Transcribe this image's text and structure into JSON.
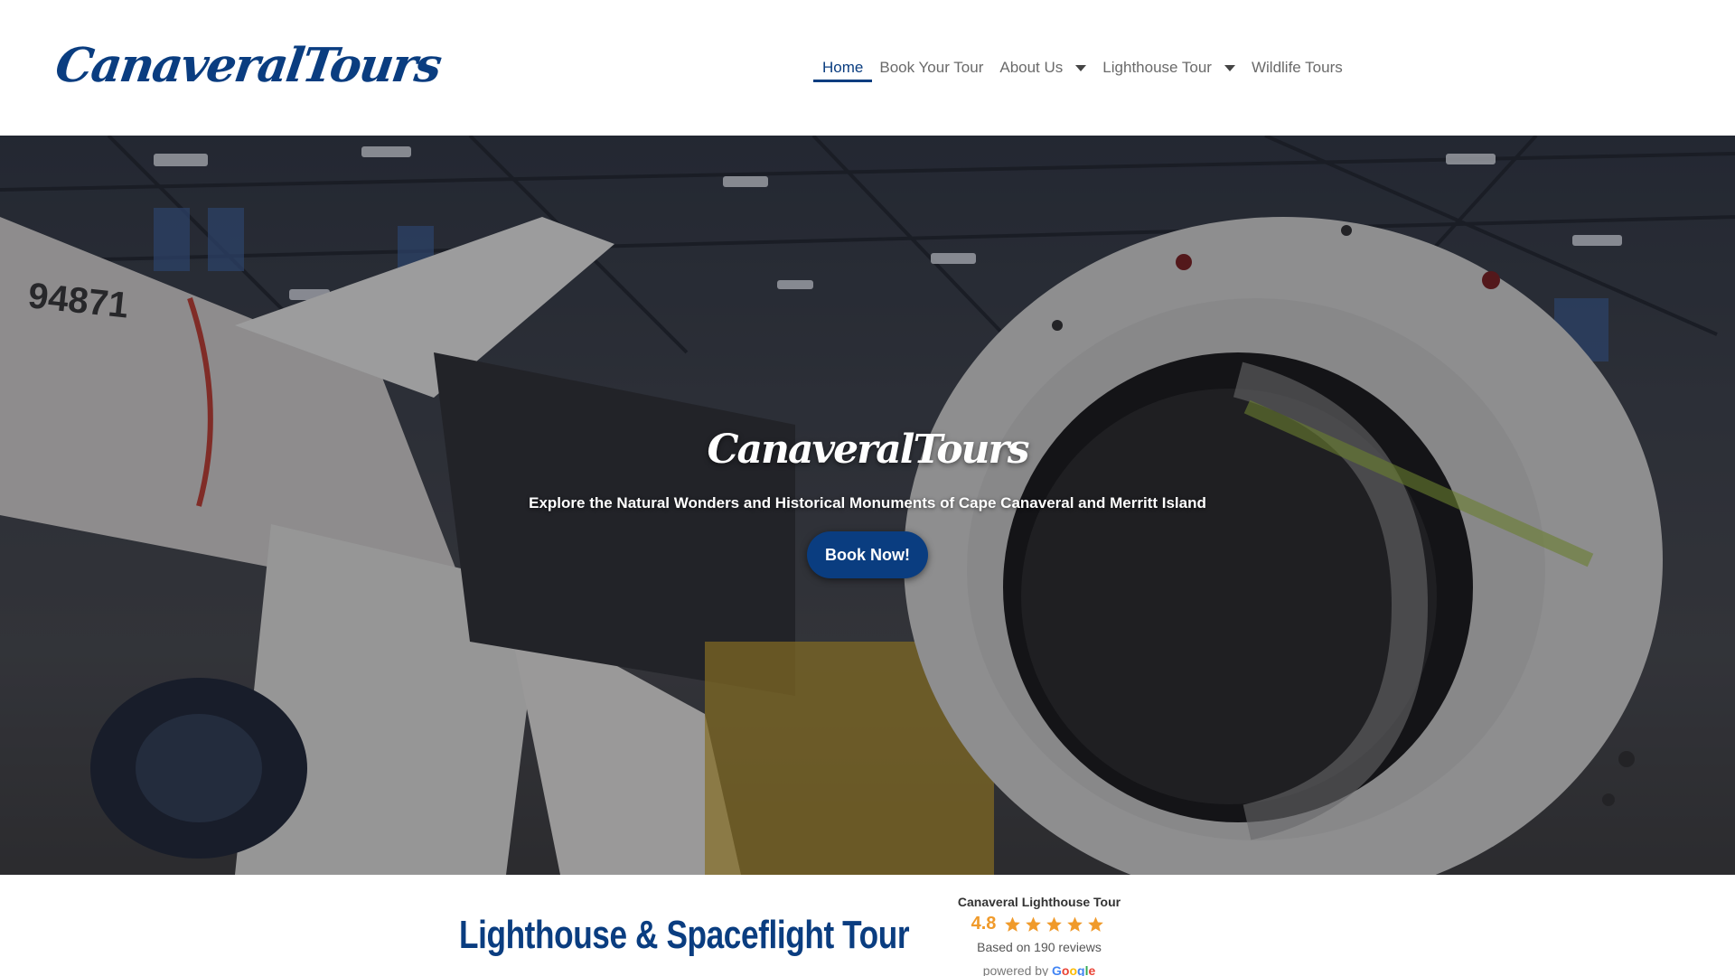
{
  "header": {
    "logo": "CanaveralTours",
    "nav": [
      {
        "label": "Home",
        "active": true
      },
      {
        "label": "Book Your Tour"
      },
      {
        "label": "About Us",
        "dropdown": true
      },
      {
        "label": "Lighthouse Tour",
        "dropdown": true
      },
      {
        "label": "Wildlife Tours"
      }
    ]
  },
  "hero": {
    "title": "CanaveralTours",
    "subtitle": "Explore the Natural Wonders and Historical Monuments of Cape Canaveral and Merritt Island",
    "button": "Book Now!",
    "rocket_number": "94871"
  },
  "section": {
    "title": "Lighthouse & Spaceflight Tour"
  },
  "review_widget": {
    "name": "Canaveral Lighthouse Tour",
    "score": "4.8",
    "stars": 5,
    "count_text": "Based on 190 reviews",
    "powered_by": "powered by",
    "google": [
      "G",
      "o",
      "o",
      "g",
      "l",
      "e"
    ]
  },
  "colors": {
    "brand_blue": "#0a3d80",
    "star_orange": "#f09a2a",
    "nav_text": "#6a6a6a"
  }
}
